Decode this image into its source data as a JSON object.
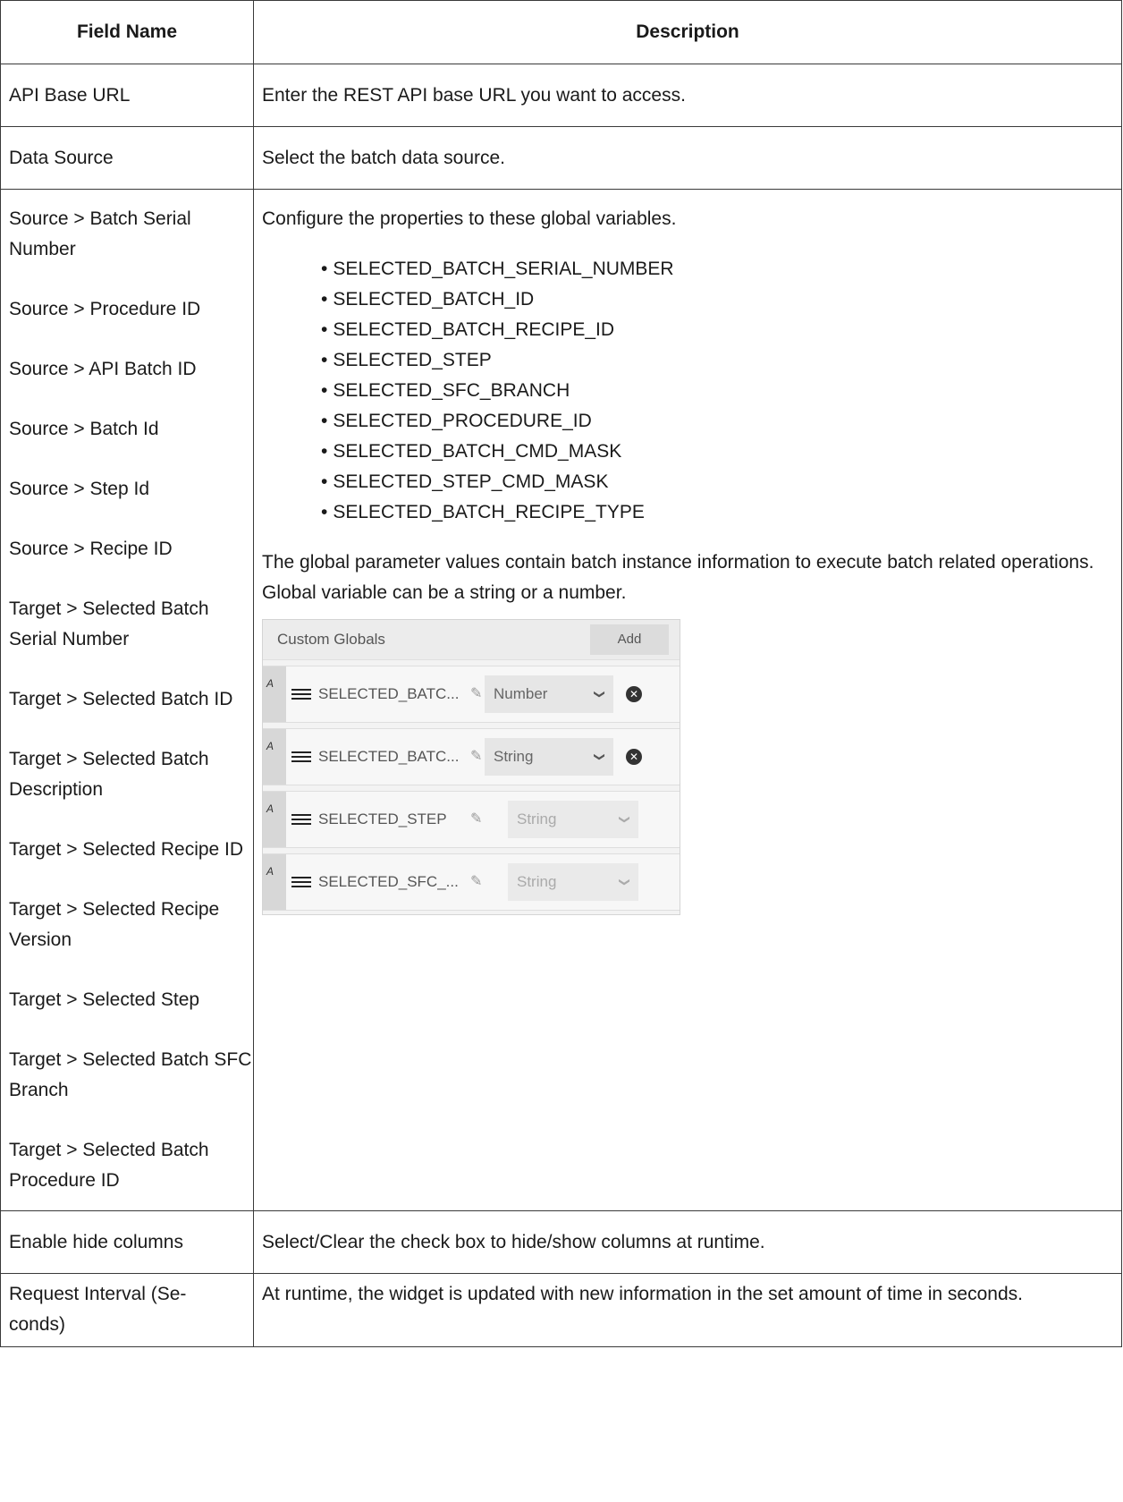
{
  "header": {
    "field_name": "Field Name",
    "description": "Description"
  },
  "rows": {
    "api_base_url": {
      "field": "API Base URL",
      "desc": "Enter the REST API base URL you want to access."
    },
    "data_source": {
      "field": "Data Source",
      "desc": "Select the batch data source."
    },
    "mapping": {
      "fields": [
        "Source > Batch Serial Number",
        "Source > Procedure ID",
        "Source > API Batch ID",
        "Source > Batch Id",
        "Source > Step Id",
        "Source > Recipe ID",
        "Target > Selected Batch Serial Number",
        "Target > Selected Batch ID",
        "Target > Selected Batch Description",
        "Target > Selected Recipe ID",
        "Target > Selected Recipe Version",
        "Target > Selected Step",
        "Target > Selected Batch SFC Branch",
        "Target > Selected Batch Procedure ID"
      ],
      "intro": "Configure the properties to these global variables.",
      "globals": [
        "SELECTED_BATCH_SERIAL_NUMBER",
        "SELECTED_BATCH_ID",
        "SELECTED_BATCH_RECIPE_ID",
        "SELECTED_STEP",
        "SELECTED_SFC_BRANCH",
        "SELECTED_PROCEDURE_ID",
        "SELECTED_BATCH_CMD_MASK",
        "SELECTED_STEP_CMD_MASK",
        "SELECTED_BATCH_RECIPE_TYPE"
      ],
      "paragraph": "The global parameter values contain batch instance information to execute batch related operations. Global variable can be a string or a number.",
      "panel": {
        "title": "Custom Globals",
        "add_label": "Add",
        "rows": [
          {
            "badge": "A",
            "name": "SELECTED_BATC...",
            "type": "Number"
          },
          {
            "badge": "A",
            "name": "SELECTED_BATC...",
            "type": "String"
          },
          {
            "badge": "A",
            "name": "SELECTED_STEP",
            "type": "String"
          },
          {
            "badge": "A",
            "name": "SELECTED_SFC_...",
            "type": "String"
          }
        ]
      }
    },
    "hide_columns": {
      "field": "Enable hide columns",
      "desc": "Select/Clear the check box to hide/show columns at runtime."
    },
    "request_interval": {
      "field_line1": "Request Interval (Se-",
      "field_line2": "conds)",
      "desc": "At runtime, the widget is updated with new information in the set amount of time in seconds."
    }
  }
}
